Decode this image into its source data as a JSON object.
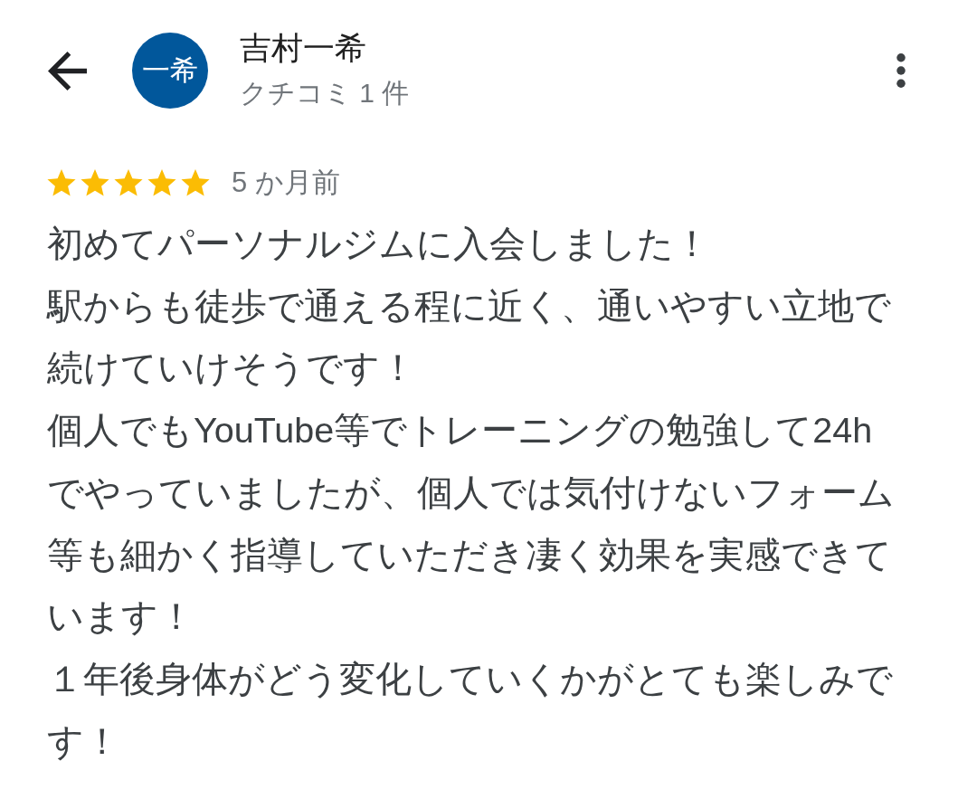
{
  "reviewer": {
    "initials": "一希",
    "name": "吉村一希",
    "review_count": "クチコミ 1 件"
  },
  "review": {
    "stars": 5,
    "time": "5 か月前",
    "paragraphs": [
      "初めてパーソナルジムに入会しました！",
      "駅からも徒歩で通える程に近く、通いやすい立地で続けていけそうです！",
      "個人でもYouTube等でトレーニングの勉強して24hでやっていましたが、個人では気付けないフォーム等も細かく指導していただき凄く効果を実感できています！",
      "１年後身体がどう変化していくかがとても楽しみです！"
    ]
  }
}
